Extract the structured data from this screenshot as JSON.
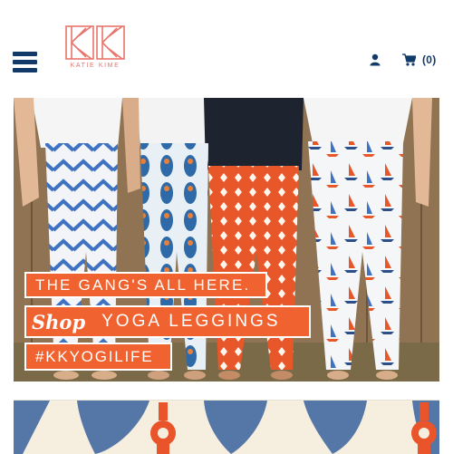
{
  "header": {
    "logo_text": "KATIE KIME",
    "cart_count": "(0)",
    "icons": {
      "menu": "hamburger-menu-icon",
      "user": "user-icon",
      "cart": "shopping-cart-icon"
    },
    "colors": {
      "nav": "#123a69",
      "brand": "#e8746b"
    }
  },
  "hero": {
    "line1": "THE GANG'S ALL HERE.",
    "shop": "Shop",
    "line2": "YOGA LEGGINGS",
    "line3": "#KKYOGILIFE",
    "colors": {
      "banner": "#f0622f"
    }
  },
  "pattern_banner": {
    "colors": {
      "blue": "#5577a8",
      "orange": "#e9542b",
      "cream": "#f6efe0"
    }
  }
}
